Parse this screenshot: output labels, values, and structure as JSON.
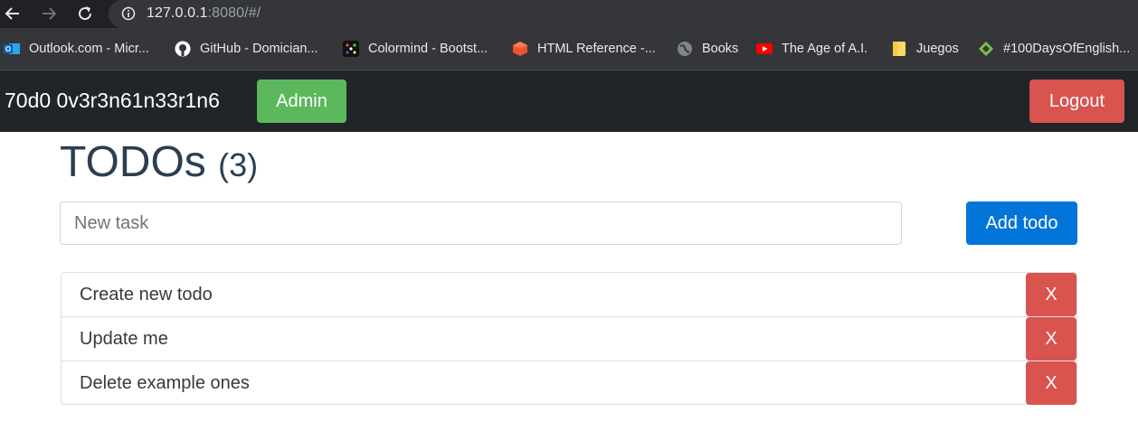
{
  "browser": {
    "url_host": "127.0.0.1",
    "url_rest": ":8080/#/",
    "bookmarks": [
      {
        "label": "Outlook.com - Micr...",
        "icon": "outlook-icon"
      },
      {
        "label": "GitHub - Domician...",
        "icon": "github-icon"
      },
      {
        "label": "Colormind - Bootst...",
        "icon": "colormind-icon"
      },
      {
        "label": "HTML Reference -...",
        "icon": "html-reference-icon"
      },
      {
        "label": "Books",
        "icon": "globe-icon"
      },
      {
        "label": "The Age of A.I.",
        "icon": "youtube-icon"
      },
      {
        "label": "Juegos",
        "icon": "folder-icon"
      },
      {
        "label": "#100DaysOfEnglish...",
        "icon": "green-diamond-icon"
      }
    ]
  },
  "navbar": {
    "brand": "70d0 0v3r3n61n33r1n6",
    "admin_label": "Admin",
    "logout_label": "Logout"
  },
  "main": {
    "title": "TODOs",
    "count": "(3)",
    "input_placeholder": "New task",
    "add_label": "Add todo",
    "todos": [
      {
        "text": "Create new todo",
        "delete_label": "X"
      },
      {
        "text": "Update me",
        "delete_label": "X"
      },
      {
        "text": "Delete example ones",
        "delete_label": "X"
      }
    ]
  },
  "colors": {
    "navbar_bg": "#212529",
    "admin": "#5cb85c",
    "logout": "#d9534f",
    "primary": "#0275d8",
    "title": "#2c3e50"
  }
}
